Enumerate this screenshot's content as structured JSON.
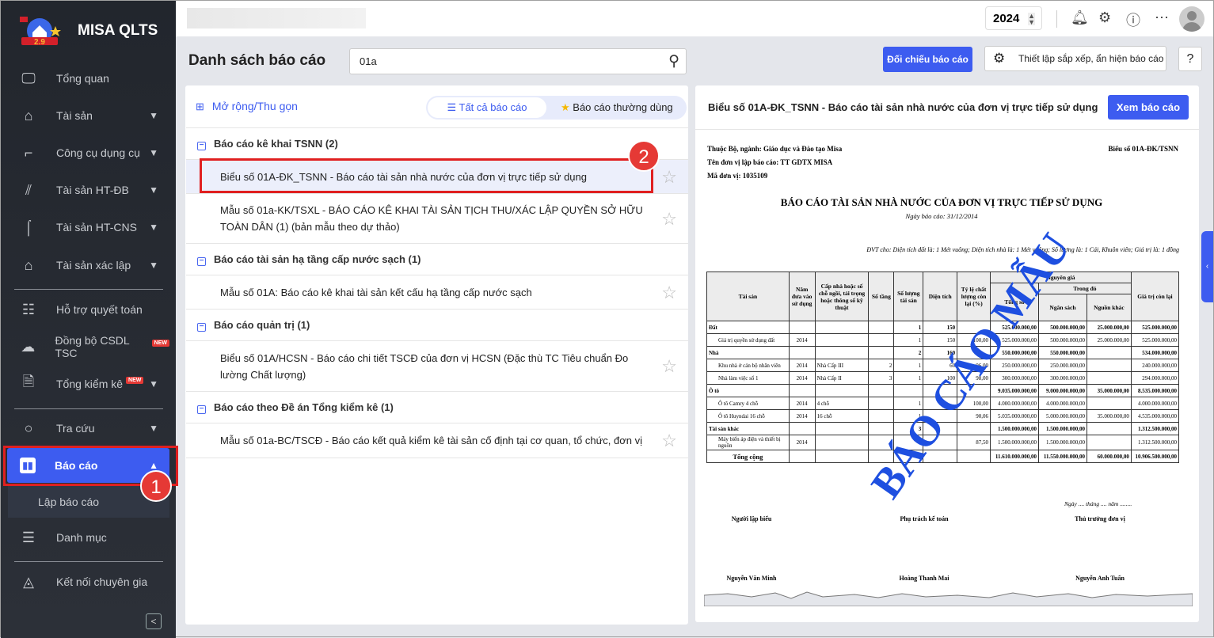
{
  "app": {
    "name": "MISA QLTS"
  },
  "sidebar": {
    "items": [
      {
        "label": "Tổng quan",
        "icon": "monitor-chart-icon"
      },
      {
        "label": "Tài sản",
        "icon": "house-car-icon"
      },
      {
        "label": "Công cụ dụng cụ",
        "icon": "paint-roller-icon"
      },
      {
        "label": "Tài sản HT-ĐB",
        "icon": "road-icon"
      },
      {
        "label": "Tài sản HT-CNS",
        "icon": "water-pipe-icon"
      },
      {
        "label": "Tài sản xác lập",
        "icon": "house-car-icon"
      },
      {
        "label": "Hỗ trợ quyết toán",
        "icon": "clipboard-icon"
      },
      {
        "label": "Đồng bộ CSDL TSC",
        "icon": "cloud-upload-icon",
        "badge": "NEW"
      },
      {
        "label": "Tổng kiểm kê",
        "icon": "document-check-icon",
        "badge": "NEW"
      },
      {
        "label": "Tra cứu",
        "icon": "search-icon"
      },
      {
        "label": "Báo cáo",
        "icon": "bar-chart-icon"
      },
      {
        "label": "Danh mục",
        "icon": "list-icon"
      },
      {
        "label": "Kết nối chuyên gia",
        "icon": "expert-icon"
      }
    ],
    "submenu": [
      "Lập báo cáo"
    ],
    "active": "Báo cáo"
  },
  "annotations": {
    "step1": "1",
    "step2": "2",
    "color": "#e02020"
  },
  "topbar": {
    "year": "2024"
  },
  "page": {
    "title": "Danh sách báo cáo",
    "search_value": "01a",
    "compare_button": "Đối chiếu báo cáo",
    "settings_button": "Thiết lập sắp xếp, ẩn hiện báo cáo"
  },
  "list": {
    "expand_label": "Mở rộng/Thu gọn",
    "tab_all": "Tất cả báo cáo",
    "tab_favorite": "Báo cáo thường dùng",
    "groups": [
      {
        "title": "Báo cáo kê khai TSNN (2)",
        "items": [
          "Biểu số 01A-ĐK_TSNN - Báo cáo tài sản nhà nước của đơn vị trực tiếp sử dụng",
          "Mẫu số 01a-KK/TSXL - BÁO CÁO KÊ KHAI TÀI SẢN TỊCH THU/XÁC LẬP QUYỀN SỞ HỮU TOÀN DÂN (1) (bản mẫu theo dự thảo)"
        ]
      },
      {
        "title": "Báo cáo tài sản hạ tầng cấp nước sạch (1)",
        "items": [
          "Mẫu số 01A: Báo cáo kê khai tài sản kết cấu hạ tầng cấp nước sạch"
        ]
      },
      {
        "title": "Báo cáo quản trị (1)",
        "items": [
          "Biểu số 01A/HCSN - Báo cáo chi tiết TSCĐ của đơn vị HCSN (Đặc thù TC Tiêu chuẩn Đo lường Chất lượng)"
        ]
      },
      {
        "title": "Báo cáo theo Đề án Tổng kiểm kê (1)",
        "items": [
          "Mẫu số 01a-BC/TSCĐ - Báo cáo kết quả kiểm kê tài sản cố định tại cơ quan, tổ chức, đơn vị"
        ]
      }
    ]
  },
  "preview": {
    "title": "Biểu số 01A-ĐK_TSNN - Báo cáo tài sản nhà nước của đơn vị trực tiếp sử dụng",
    "view_button": "Xem báo cáo",
    "doc": {
      "ministry": "Thuộc Bộ, ngành: Giáo dục và Đào tạo Misa",
      "unit": "Tên đơn vị lập báo cáo: TT GDTX MISA",
      "code": "Mã đơn vị: 1035109",
      "form": "Biểu số 01A-ĐK/TSNN",
      "title": "BÁO CÁO TÀI SẢN NHÀ NƯỚC CỦA ĐƠN VỊ TRỰC TIẾP SỬ DỤNG",
      "date": "Ngày báo cáo: 31/12/2014",
      "units": "ĐVT cho: Diện tích đất là: 1 Mét vuông; Diện tích nhà là: 1 Mét vuông; Số lượng là: 1 Cái, Khuôn viên; Giá trị là: 1 đồng",
      "headers": {
        "asset": "Tài sản",
        "year": "Năm đưa vào sử dụng",
        "grade": "Cấp nhà hoặc số chỗ ngồi, tải trọng hoặc thông số kỹ thuật",
        "floors": "Số tầng",
        "qty": "Số lượng tài sản",
        "area": "Diện tích",
        "quality": "Tỷ lệ chất lượng còn lại (%)",
        "original": "Nguyên giá",
        "total": "Tổng số",
        "of_which": "Trong đó",
        "budget": "Ngân sách",
        "other": "Nguồn khác",
        "remaining": "Giá trị còn lại"
      },
      "rows": [
        {
          "group": true,
          "cells": [
            "Đất",
            "",
            "",
            "",
            "1",
            "150",
            "",
            "525.000.000,00",
            "500.000.000,00",
            "25.000.000,00",
            "525.000.000,00"
          ]
        },
        {
          "group": false,
          "cells": [
            "Giá trị quyền sử dụng đất",
            "2014",
            "",
            "",
            "1",
            "150",
            "100,00",
            "525.000.000,00",
            "500.000.000,00",
            "25.000.000,00",
            "525.000.000,00"
          ]
        },
        {
          "group": true,
          "cells": [
            "Nhà",
            "",
            "",
            "",
            "2",
            "160",
            "",
            "550.000.000,00",
            "550.000.000,00",
            "",
            "534.000.000,00"
          ]
        },
        {
          "group": false,
          "cells": [
            "Khu nhà ở cán bộ nhân viên",
            "2014",
            "Nhà Cấp III",
            "2",
            "1",
            "60",
            "96,00",
            "250.000.000,00",
            "250.000.000,00",
            "",
            "240.000.000,00"
          ]
        },
        {
          "group": false,
          "cells": [
            "Nhà làm việc số 1",
            "2014",
            "Nhà Cấp II",
            "3",
            "1",
            "100",
            "98,00",
            "300.000.000,00",
            "300.000.000,00",
            "",
            "294.000.000,00"
          ]
        },
        {
          "group": true,
          "cells": [
            "Ô tô",
            "",
            "",
            "",
            "",
            "",
            "",
            "9.035.000.000,00",
            "9.000.000.000,00",
            "35.000.000,00",
            "8.535.000.000,00"
          ]
        },
        {
          "group": false,
          "cells": [
            "Ô tô Camry 4 chỗ",
            "2014",
            "4 chỗ",
            "",
            "1",
            "",
            "100,00",
            "4.000.000.000,00",
            "4.000.000.000,00",
            "",
            "4.000.000.000,00"
          ]
        },
        {
          "group": false,
          "cells": [
            "Ô tô Huyndai 16 chỗ",
            "2014",
            "16 chỗ",
            "",
            "1",
            "",
            "90,06",
            "5.035.000.000,00",
            "5.000.000.000,00",
            "35.000.000,00",
            "4.535.000.000,00"
          ]
        },
        {
          "group": true,
          "cells": [
            "Tài sản khác",
            "",
            "",
            "",
            "3",
            "",
            "",
            "1.500.000.000,00",
            "1.500.000.000,00",
            "",
            "1.312.500.000,00"
          ]
        },
        {
          "group": false,
          "cells": [
            "Máy biến áp điện và thiết bị nguồn",
            "2014",
            "",
            "",
            "3",
            "",
            "87,50",
            "1.500.000.000,00",
            "1.500.000.000,00",
            "",
            "1.312.500.000,00"
          ]
        },
        {
          "group": true,
          "total": true,
          "cells": [
            "Tổng cộng",
            "",
            "",
            "",
            "8",
            "",
            "",
            "11.610.000.000,00",
            "11.550.000.000,00",
            "60.000.000,00",
            "10.906.500.000,00"
          ]
        }
      ],
      "sign_date": "Ngày .... tháng .... năm ........",
      "signers": [
        {
          "role": "Người lập biểu",
          "name": "Nguyễn Văn Minh"
        },
        {
          "role": "Phụ trách kế toán",
          "name": "Hoàng Thanh Mai"
        },
        {
          "role": "Thủ trưởng đơn vị",
          "name": "Nguyễn Anh Tuấn"
        }
      ],
      "watermark": "BÁO CÁO MẪU"
    }
  }
}
